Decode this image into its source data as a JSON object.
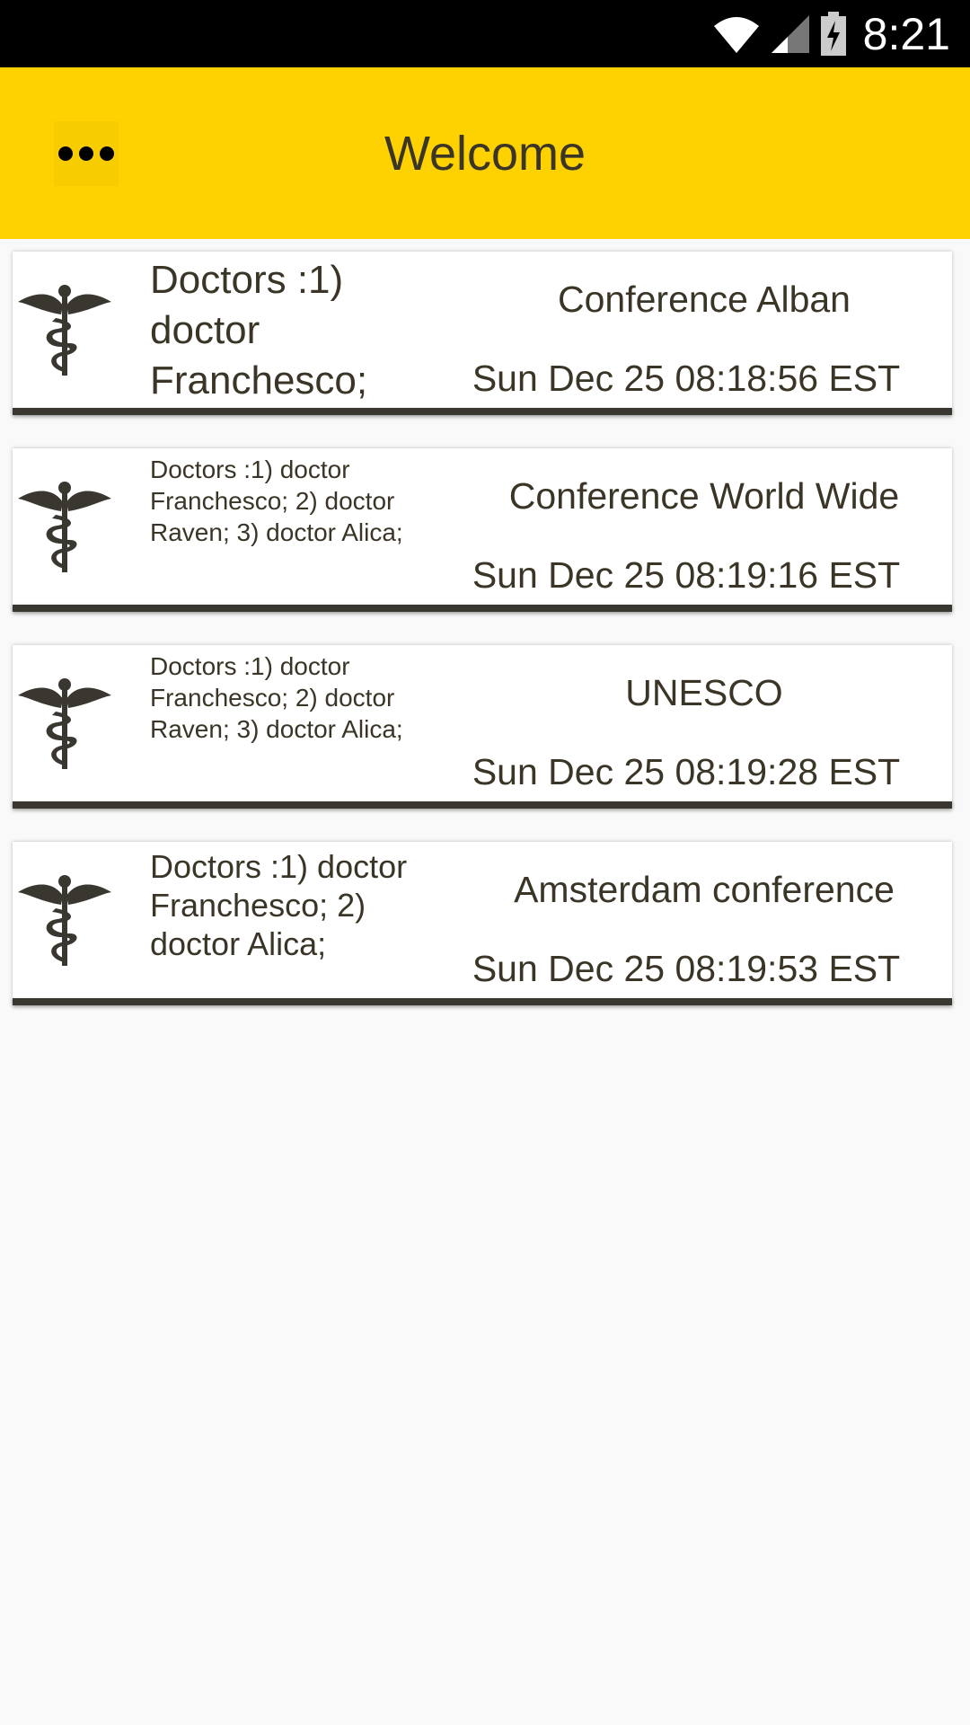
{
  "status_bar": {
    "time": "8:21",
    "icons": [
      "wifi-icon",
      "signal-icon",
      "battery-charging-icon"
    ]
  },
  "app_bar": {
    "title": "Welcome",
    "menu_icon": "more-dots-icon",
    "background": "#fed100"
  },
  "conferences": [
    {
      "icon": "caduceus-icon",
      "doctors": "Doctors :1) doctor Franchesco;",
      "name": "Conference Alban",
      "date": "Sun Dec 25 08:18:56 EST"
    },
    {
      "icon": "caduceus-icon",
      "doctors": "Doctors :1) doctor Franchesco; 2) doctor Raven; 3) doctor Alica;",
      "name": "Conference World Wide",
      "date": "Sun Dec 25 08:19:16 EST"
    },
    {
      "icon": "caduceus-icon",
      "doctors": "Doctors :1) doctor Franchesco; 2) doctor Raven; 3) doctor Alica;",
      "name": "UNESCO",
      "date": "Sun Dec 25 08:19:28 EST"
    },
    {
      "icon": "caduceus-icon",
      "doctors": "Doctors :1) doctor Franchesco; 2) doctor Alica;",
      "name": "Amsterdam conference",
      "date": "Sun Dec 25 08:19:53 EST"
    }
  ]
}
